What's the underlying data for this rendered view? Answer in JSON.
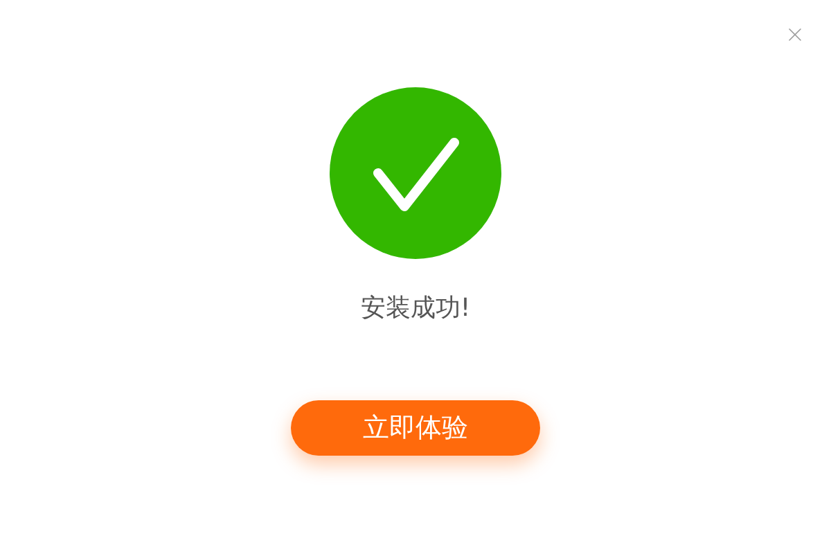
{
  "status": {
    "message": "安装成功!",
    "success": true
  },
  "button": {
    "label": "立即体验"
  }
}
